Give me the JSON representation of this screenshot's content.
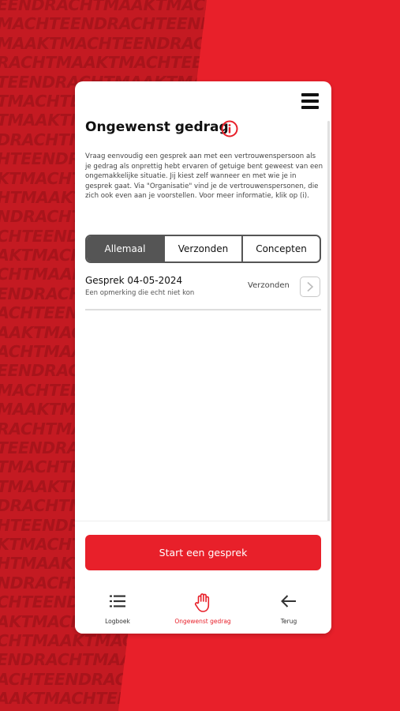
{
  "background": {
    "pattern_lines": [
      "EENDRACHTMAAKTMACHTEEN",
      "MACHTEENDRACHTEENDRACH",
      "MAAKTMACHTEENDRACHTMAA",
      "RACHTMAAKTMACHTEENDRAC",
      "TEENDRACHTMAAKTMACHTEE",
      "TMACHTEENDRACHTMAAKTMA",
      "TMAAKTMACHTEENDRACHTMA",
      "DRACHTMAAKTMACHTEENDRA",
      "HTEENDRACHTMAAKTMACHTE",
      "KTMACHTEENDRACHTMAAKTM",
      "HTMAAKTMACHTEENDRACHTM",
      "NDRACHTMAAKTMACHTEENDR",
      "CHTEENDRACHTMAAKTMACHT",
      "AKTMACHTEENDRACHTMAAKT",
      "CHTMAAKTMACHTEENDRACHT",
      "ENDRACHTMAAKTMACHTEEND",
      "ACHTEENDRACHTMAAKTMACH",
      "AAKTMACHTEENDRACHTMAAK",
      "ACHTMAAKTMACHTEENDRACH",
      "EENDRACHTMAAKTMACHTEEN",
      "MACHTEENDRACHTEENDRACH",
      "MAAKTMACHTEENDRACHTMAA",
      "RACHTMAAKTMACHTEENDRAC",
      "TEENDRACHTMAAKTMACHTEE",
      "TMACHTEENDRACHTMAAKTMA",
      "TMAAKTMACHTEENDRACHTMA",
      "DRACHTMAAKTMACHTEENDRA",
      "HTEENDRACHTMAAKTMACHTE",
      "KTMACHTEENDRACHTMAAKTM",
      "HTMAAKTMACHTEENDRACHTM",
      "NDRACHTMAAKTMACHTEENDR",
      "CHTEENDRACHTMAAKTMACHT",
      "AKTMACHTEENDRACHTMAAKT",
      "CHTMAAKTMACHTEENDRACHT",
      "ENDRACHTMAAKTMACHTEEND",
      "ACHTEENDRACHTMAAKTMACH",
      "AAKTMACHTEENDRACHTMAAK"
    ]
  },
  "header": {
    "menu_icon": "hamburger-menu-icon",
    "title": "Ongewenst gedrag",
    "info_icon": "info-circle-icon"
  },
  "description": "Vraag eenvoudig een gesprek aan met een vertrouwenspersoon als je gedrag als onprettig hebt ervaren of getuige bent geweest van een ongemakkelijke situatie. Jij kiest zelf wanneer en met wie je in gesprek gaat. Via \"Organisatie\" vind je de vertrouwenspersonen, die zich ook even aan je voorstellen. Voor meer informatie, klik op (i).",
  "tabs": [
    {
      "label": "Allemaal",
      "active": true
    },
    {
      "label": "Verzonden",
      "active": false
    },
    {
      "label": "Concepten",
      "active": false
    }
  ],
  "items": [
    {
      "title": "Gesprek 04-05-2024",
      "subtitle": "Een opmerking die echt niet kon",
      "status": "Verzonden"
    }
  ],
  "start_button": "Start een gesprek",
  "nav": [
    {
      "label": "Logboek",
      "icon": "list-icon",
      "active": false
    },
    {
      "label": "Ongewenst gedrag",
      "icon": "hand-stop-icon",
      "active": true
    },
    {
      "label": "Terug",
      "icon": "arrow-left-icon",
      "active": false
    }
  ],
  "colors": {
    "brand_red": "#e8202a",
    "dark_red": "#c41a22",
    "tab_active": "#555555"
  }
}
